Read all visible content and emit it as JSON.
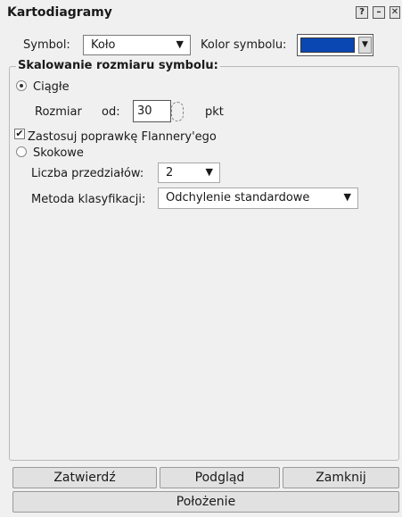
{
  "window": {
    "title": "Kartodiagramy",
    "controls": {
      "help": "?",
      "minimize": "–",
      "close": "✕"
    }
  },
  "symbol": {
    "label": "Symbol:",
    "value": "Koło"
  },
  "symbol_color": {
    "label": "Kolor symbolu:",
    "value": "#0b47b3"
  },
  "scaling": {
    "legend": "Skalowanie rozmiaru symbolu:",
    "continuous_label": "Ciągłe",
    "continuous_selected": true,
    "size_label": "Rozmiar",
    "from_label": "od:",
    "size_value": "30",
    "unit_label": "pkt",
    "flannery_label": "Zastosuj poprawkę Flannery'ego",
    "flannery_checked": true,
    "graduated_label": "Skokowe",
    "graduated_selected": false,
    "classes_label": "Liczba przedziałów:",
    "classes_value": "2",
    "method_label": "Metoda klasyfikacji:",
    "method_value": "Odchylenie standardowe"
  },
  "buttons": {
    "confirm": "Zatwierdź",
    "preview": "Podgląd",
    "close": "Zamknij",
    "position": "Położenie"
  }
}
